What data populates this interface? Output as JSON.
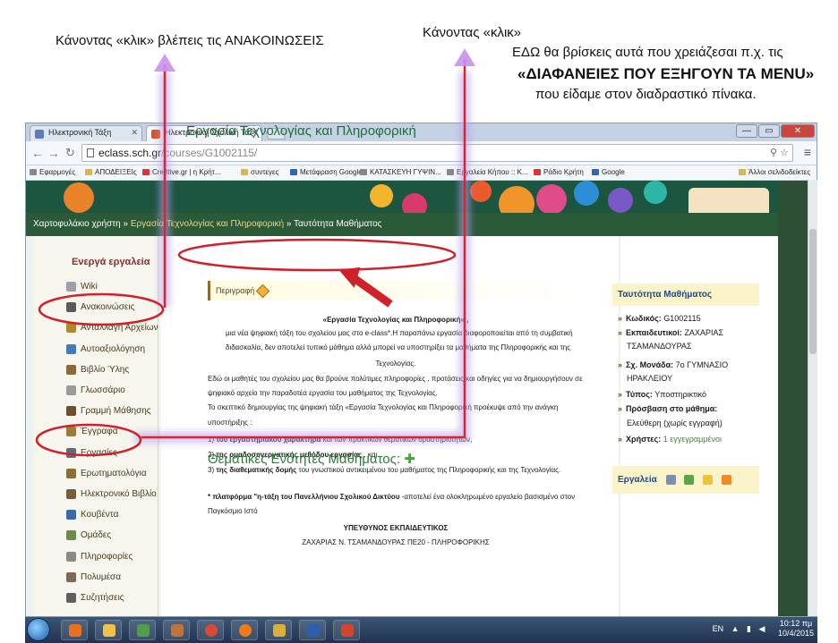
{
  "annotations": {
    "left_note": "Κάνοντας «κλικ» βλέπεις τις ΑΝΑΚΟΙΝΩΣΕΙΣ",
    "click_note": "Κάνοντας «κλικ»",
    "here_note": "ΕΔΩ θα βρίσκεις αυτά που χρειάζεσαι π.χ. τις",
    "slides_note": "«ΔΙΑΦΑΝΕΙΕΣ ΠΟΥ ΕΞΗΓΟΥΝ ΤΑ MENU»",
    "board_note": "που είδαμε στον διαδραστικό πίνακα."
  },
  "browser": {
    "tabs": [
      {
        "label": "Ηλεκτρονική Τάξη",
        "active": false
      },
      {
        "label": "Ηλεκτρονική Σχολική Τάξ",
        "active": true
      }
    ],
    "url_host": "eclass.sch.gr",
    "url_path": "/courses/G1002115/",
    "window_controls": {
      "minimize": "—",
      "maximize": "▭",
      "close": "✕"
    },
    "bookmarks": [
      {
        "label": "Εφαρμογές",
        "color": "grid"
      },
      {
        "label": "ΑΠΟΔΕΙΞΕΙς",
        "color": "folder"
      },
      {
        "label": "Cre8tive.gr | η Κρήτ...",
        "color": "red"
      },
      {
        "label": "συντεγες",
        "color": "folder"
      },
      {
        "label": "Μετάφραση Google",
        "color": "blue"
      },
      {
        "label": "ΚΑΤΑΣΚΕΥΗ ΓΥΨΙΝ...",
        "color": "grey"
      },
      {
        "label": "Εργαλεία Κήπου :: K...",
        "color": "grey"
      },
      {
        "label": "Ράδιο Κρήτη",
        "color": "red"
      },
      {
        "label": "Google",
        "color": "blue"
      },
      {
        "label": "Άλλοι σελιδοδείκτες",
        "color": "folder"
      }
    ]
  },
  "site": {
    "breadcrumb": {
      "home": "Χαρτοφυλάκιο χρήστη",
      "course": "Εργασία Τεχνολογίας και Πληροφορική",
      "current": "Ταυτότητα Μαθήματος",
      "sep": "»"
    },
    "sidebar": {
      "heading": "Ενεργά εργαλεία",
      "items": [
        {
          "label": "Wiki",
          "icon": "wiki-icon"
        },
        {
          "label": "Ανακοινώσεις",
          "icon": "clock-icon"
        },
        {
          "label": "Ανταλλαγή Αρχείων",
          "icon": "exchange-icon"
        },
        {
          "label": "Αυτοαξιολόγηση",
          "icon": "check-icon"
        },
        {
          "label": "Βιβλίο Ύλης",
          "icon": "book-icon"
        },
        {
          "label": "Γλωσσάριο",
          "icon": "glossary-icon"
        },
        {
          "label": "Γραμμή Μάθησης",
          "icon": "path-icon"
        },
        {
          "label": "Έγγραφα",
          "icon": "folder-icon"
        },
        {
          "label": "Εργασίες",
          "icon": "tasks-icon"
        },
        {
          "label": "Ερωτηματολόγια",
          "icon": "survey-icon"
        },
        {
          "label": "Ηλεκτρονικό Βιβλίο",
          "icon": "ebook-icon"
        },
        {
          "label": "Κουβέντα",
          "icon": "chat-icon"
        },
        {
          "label": "Ομάδες",
          "icon": "groups-icon"
        },
        {
          "label": "Πληροφορίες",
          "icon": "info-icon"
        },
        {
          "label": "Πολυμέσα",
          "icon": "media-icon"
        },
        {
          "label": "Συζητήσεις",
          "icon": "forum-icon"
        }
      ]
    },
    "main": {
      "title": "Εργασία Τεχνολογίας και Πληροφορική",
      "description_label": "Περιγραφή",
      "desc_title": "«Εργασία Τεχνολογίας και Πληροφορική» ,",
      "desc_lines": [
        "μια νέα ψηφιακή τάξη του σχολείου μας στο e-class*.Η παραπάνω εργασία  διαφοροποιείται από τη συμβατική",
        "διδασκαλία,  δεν  αποτελεί τυπικό μάθημα αλλά μπορεί να υποστηρίξει τα μαθήματα της Πληροφορικής και της",
        "Τεχνολογίας.",
        "Εδώ  οι μαθητές του σχολείου μας θα βρούνε πολύτιμες πληροφορίες , προτάσεις  και οδηγίες για να δημιουργήσουν σε",
        "ψηφιακό αρχείο την παραδοτέα εργασία του μαθήματος της Τεχνολογίας.",
        "Το σκεπτικό δημιουργίας της ψηφιακή τάξη «Εργασία Τεχνολογίας και Πληροφορική  προέκυψε από την ανάγκη",
        "υποστήριξης :"
      ],
      "reasons": [
        {
          "num": "1)",
          "bold": "του εργαστηριακού χαρακτήρα",
          "rest": " και των πρακτικών  θεματικών δραστηριοτήτων,"
        },
        {
          "num": "2)",
          "bold": "της ομαδοσυνεργατικής μεθόδου εργασίας",
          "rest": " , και"
        },
        {
          "num": "3)",
          "bold": "της διαθεματικής δομής",
          "rest": "  του γνωστικού αντικειμένου του μαθήματος της Πληροφορικής και της Τεχνολογίας."
        }
      ],
      "footnote_bold": "* πλατφόρμα \"η-τάξη του Πανελλήνιου Σχολικού Δικτύου",
      "footnote_rest": " -αποτελεί ένα ολοκληρωμένο εργαλείο βασισμένο στον",
      "footnote_line2": "Παγκόσμιο Ιστό",
      "responsible_head": "ΥΠΕΥΘΥΝΟΣ ΕΚΠΑΙΔΕΥΤΙΚΟΣ",
      "responsible_name": "ΖΑΧΑΡΙΑΣ Ν. ΤΣΑΜΑΝΔΟΥΡΑΣ ΠΕ20 - ΠΛΗΡΟΦΟΡΙΚΗΣ",
      "themes_title": "Θεματικές Ενότητες Μαθήματος:"
    },
    "identity": {
      "heading": "Ταυτότητα Μαθήματος",
      "code_label": "Κωδικός:",
      "code": "G1002115",
      "teachers_label": "Εκπαιδευτικοί:",
      "teachers_1": "ΖΑΧΑΡΙΑΣ",
      "teachers_2": "ΤΣΑΜΑΝΔΟΥΡΑΣ",
      "unit_label": "Σχ. Μονάδα:",
      "unit_1": "7ο ΓΥΜΝΑΣΙΟ",
      "unit_2": "ΗΡΑΚΛΕΙΟΥ",
      "type_label": "Τύπος:",
      "type": "Υποστηρικτικό",
      "access_label": "Πρόσβαση στο μάθημα:",
      "access": "Ελεύθερη (χωρίς εγγραφή)",
      "users_label": "Χρήστες:",
      "users": "1 εγγεγραμμένοι"
    },
    "tools_box": {
      "label": "Εργαλεία"
    }
  },
  "taskbar": {
    "lang": "EN",
    "time": "10:12 πμ",
    "date": "10/4/2015"
  }
}
